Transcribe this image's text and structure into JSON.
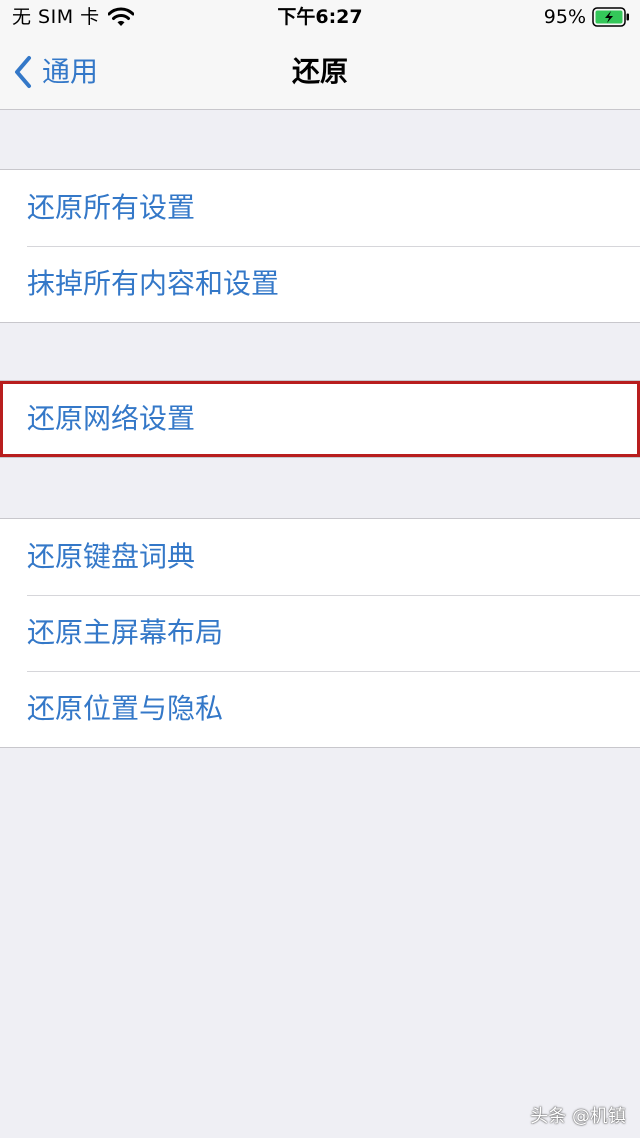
{
  "status_bar": {
    "carrier": "无 SIM 卡",
    "time": "下午6:27",
    "battery": "95%",
    "icons": [
      "wifi-icon",
      "battery-charging-icon"
    ]
  },
  "nav": {
    "back_label": "通用",
    "title": "还原",
    "back_icon": "chevron-left-icon"
  },
  "groups": [
    {
      "items": [
        {
          "label": "还原所有设置"
        },
        {
          "label": "抹掉所有内容和设置"
        }
      ]
    },
    {
      "items": [
        {
          "label": "还原网络设置",
          "highlighted": true
        }
      ]
    },
    {
      "items": [
        {
          "label": "还原键盘词典"
        },
        {
          "label": "还原主屏幕布局"
        },
        {
          "label": "还原位置与隐私"
        }
      ]
    }
  ],
  "colors": {
    "accent": "#3478c8",
    "highlight_border": "#b81e1e",
    "background": "#efeff4"
  },
  "watermark": "头条 @机镇"
}
